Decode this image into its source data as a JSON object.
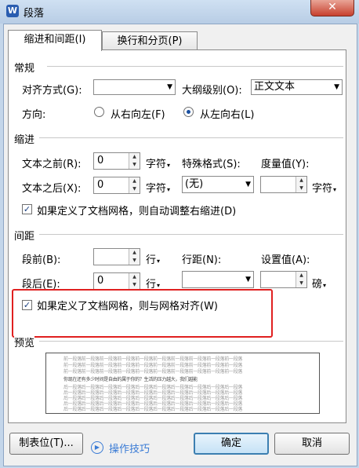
{
  "window": {
    "title": "段落",
    "app_icon": "W",
    "close": "✕"
  },
  "tabs": [
    {
      "label": "缩进和间距(I)",
      "active": true
    },
    {
      "label": "换行和分页(P)",
      "active": false
    }
  ],
  "general": {
    "heading": "常规",
    "align_label": "对齐方式(G):",
    "align_value": "",
    "outline_label": "大纲级别(O):",
    "outline_value": "正文文本",
    "direction_label": "方向:",
    "rtl_label": "从右向左(F)",
    "ltr_label": "从左向右(L)",
    "direction_selected": "ltr"
  },
  "indent": {
    "heading": "缩进",
    "before_label": "文本之前(R):",
    "before_value": "0",
    "before_unit": "字符",
    "after_label": "文本之后(X):",
    "after_value": "0",
    "after_unit": "字符",
    "special_label": "特殊格式(S):",
    "special_value": "(无)",
    "measure_label": "度量值(Y):",
    "measure_value": "",
    "measure_unit": "字符",
    "auto_adjust_label": "如果定义了文档网格，则自动调整右缩进(D)",
    "auto_adjust_checked": true
  },
  "spacing": {
    "heading": "间距",
    "before_label": "段前(B):",
    "before_value": "",
    "before_unit": "行",
    "after_label": "段后(E):",
    "after_value": "0",
    "after_unit": "行",
    "line_label": "行距(N):",
    "line_value": "",
    "setting_label": "设置值(A):",
    "setting_value": "",
    "setting_unit": "磅",
    "grid_align_label": "如果定义了文档网格，则与网格对齐(W)",
    "grid_align_checked": true
  },
  "preview": {
    "heading": "预览",
    "lines": [
      "前一段落前一段落前一段落前一段落前一段落前一段落前一段落前一段落前一段落前一段落",
      "前一段落前一段落前一段落前一段落前一段落前一段落前一段落前一段落前一段落前一段落",
      "前一段落前一段落前一段落前一段落前一段落前一段落前一段落前一段落前一段落前一段落",
      "你现在还有多少时间是自由的属于你的？生活的压力越大，我们越能",
      "后一段落后一段落后一段落后一段落后一段落后一段落后一段落后一段落后一段落后一段落",
      "后一段落后一段落后一段落后一段落后一段落后一段落后一段落后一段落后一段落后一段落",
      "后一段落后一段落后一段落后一段落后一段落后一段落后一段落后一段落后一段落后一段落",
      "后一段落后一段落后一段落后一段落后一段落后一段落后一段落后一段落后一段落后一段落",
      "后一段落后一段落后一段落后一段落后一段落后一段落后一段落后一段落后一段落后一段落"
    ]
  },
  "footer": {
    "tabs_button": "制表位(T)...",
    "tips_label": "操作技巧",
    "ok_button": "确定",
    "cancel_button": "取消"
  },
  "colors": {
    "highlight": "#e02020",
    "accent": "#3a7bd5"
  }
}
